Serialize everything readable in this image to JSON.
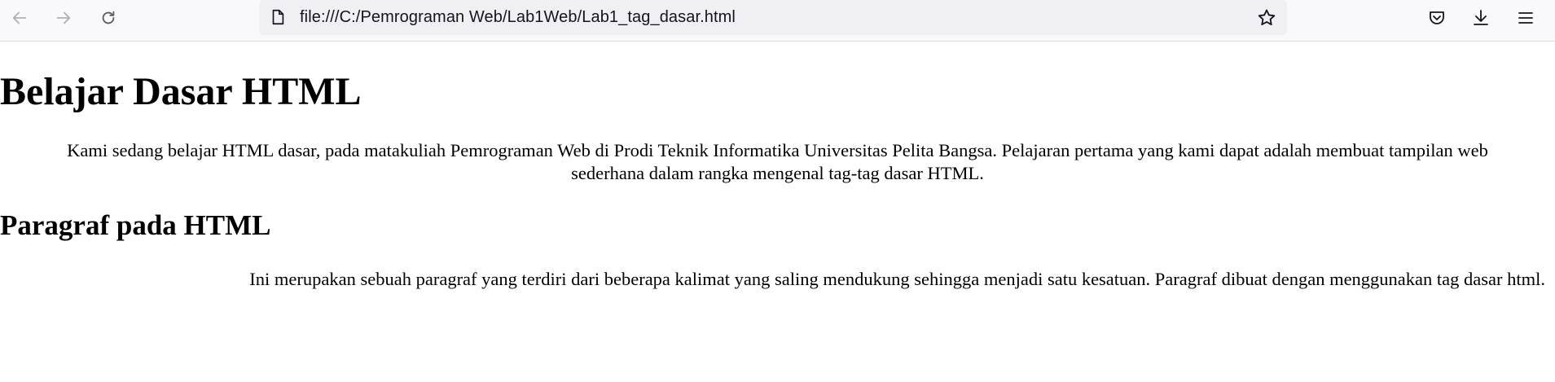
{
  "browser": {
    "url": "file:///C:/Pemrograman Web/Lab1Web/Lab1_tag_dasar.html",
    "icons": {
      "back": "back-arrow-icon",
      "forward": "forward-arrow-icon",
      "reload": "reload-icon",
      "page": "page-icon",
      "bookmark": "star-icon",
      "pocket": "pocket-icon",
      "downloads": "download-icon",
      "menu": "hamburger-menu-icon"
    },
    "colors": {
      "toolbar_bg": "#f9f9fb",
      "urlbar_bg": "#f0f0f4",
      "icon_disabled": "#b0b0b8",
      "icon_active": "#5b5b66"
    }
  },
  "page": {
    "heading": "Belajar Dasar HTML",
    "intro_line1": "Kami sedang belajar HTML dasar, pada matakuliah Pemrograman Web di Prodi Teknik Informatika Universitas Pelita Bangsa. Pelajaran pertama yang kami dapat adalah membuat tampilan web",
    "intro_line2": "sederhana dalam rangka mengenal tag-tag dasar HTML.",
    "subheading": "Paragraf pada HTML",
    "paragraph": "Ini merupakan sebuah paragraf yang terdiri dari beberapa kalimat yang saling mendukung sehingga menjadi satu kesatuan. Paragraf dibuat dengan menggunakan tag dasar html."
  }
}
